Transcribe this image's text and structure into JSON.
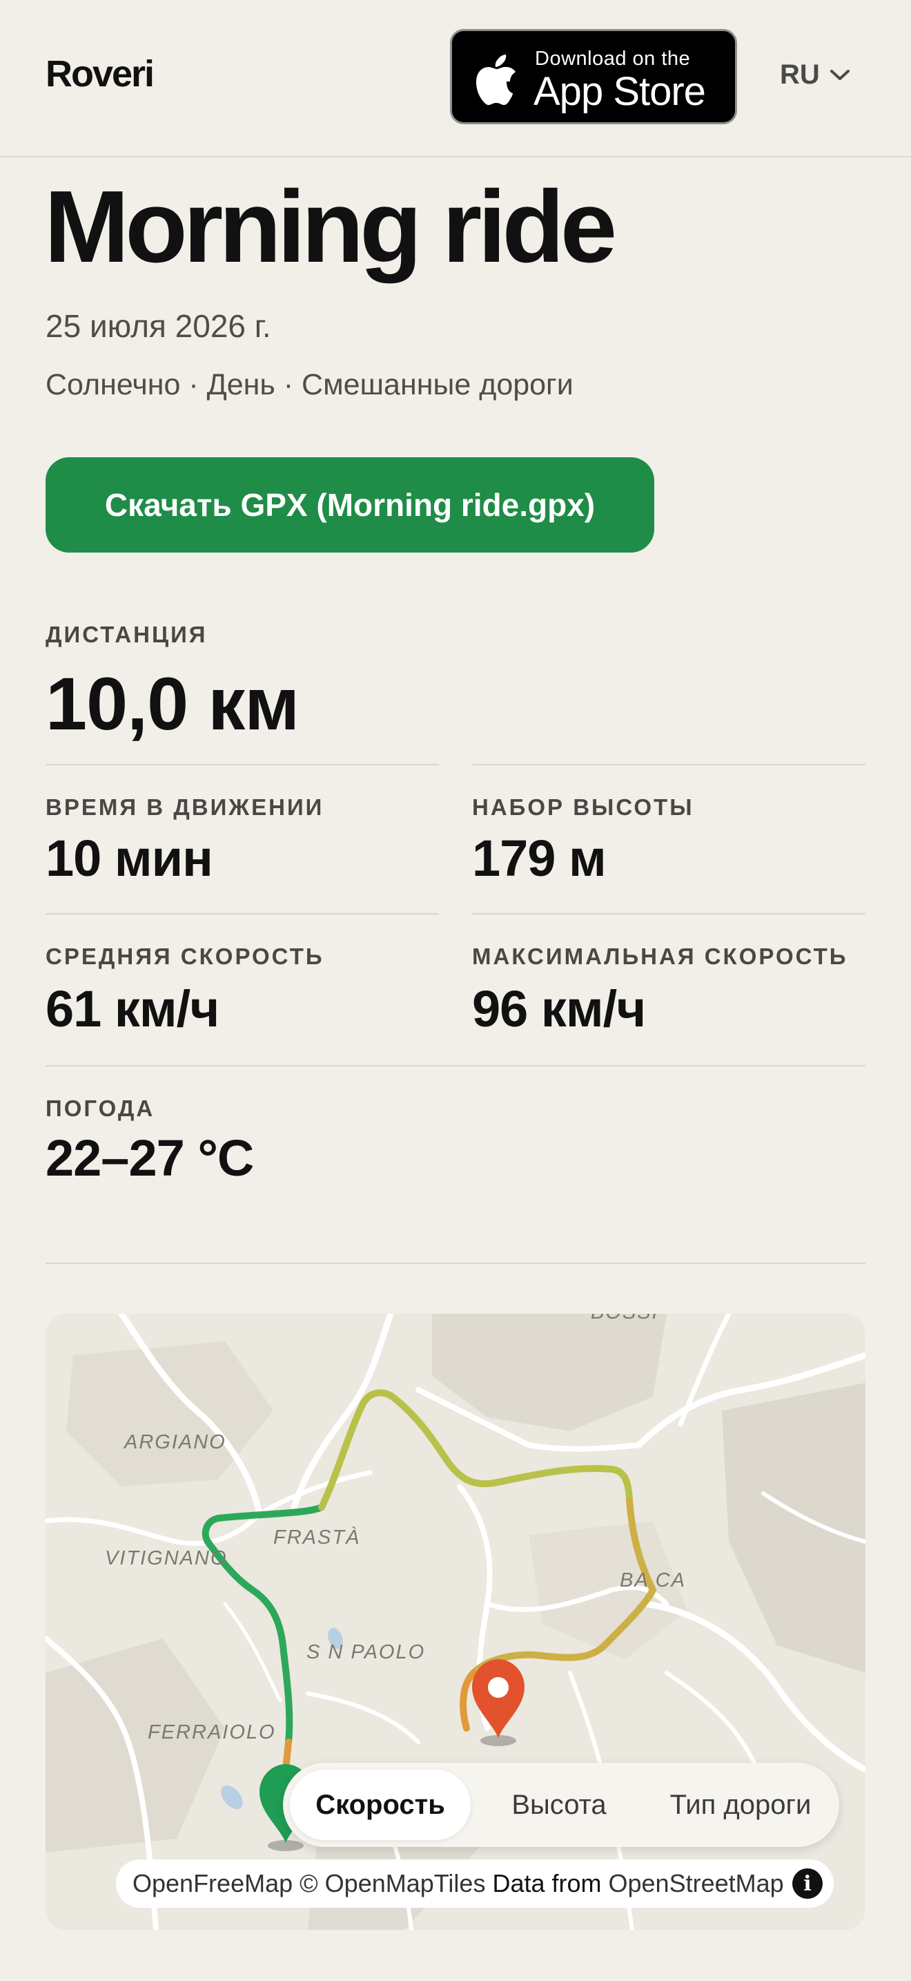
{
  "header": {
    "logo": "Roveri",
    "appstore": {
      "small": "Download on the",
      "big": "App Store"
    },
    "language": "RU"
  },
  "ride": {
    "title": "Morning ride",
    "date": "25 июля 2026 г.",
    "tags": "Солнечно · День · Смешанные дороги",
    "download_label": "Скачать GPX (Morning ride.gpx)"
  },
  "stats": {
    "distance": {
      "label": "ДИСТАНЦИЯ",
      "value": "10,0 км"
    },
    "moving_time": {
      "label": "ВРЕМЯ В ДВИЖЕНИИ",
      "value": "10 мин"
    },
    "elevation_gain": {
      "label": "НАБОР ВЫСОТЫ",
      "value": "179 м"
    },
    "avg_speed": {
      "label": "СРЕДНЯЯ СКОРОСТЬ",
      "value": "61 км/ч"
    },
    "max_speed": {
      "label": "МАКСИМАЛЬНАЯ СКОРОСТЬ",
      "value": "96 км/ч"
    },
    "weather": {
      "label": "ПОГОДА",
      "value": "22–27 °C"
    }
  },
  "map": {
    "places": [
      "ARGIANO",
      "FRASTÀ",
      "VITIGNANO",
      "BA CA",
      "S N PAOLO",
      "FERRAIOLO",
      "BOSSI"
    ],
    "tabs": [
      "Скорость",
      "Высота",
      "Тип дороги"
    ],
    "active_tab": "Скорость",
    "attribution": {
      "openfreemap": "OpenFreeMap",
      "openmaptiles": "© OpenMapTiles",
      "data_from": "Data from",
      "osm": "OpenStreetMap"
    },
    "colors": {
      "start": "#1f9d55",
      "finish": "#e2532d",
      "route_slow": "#2da85a",
      "route_mid": "#b8c24a",
      "route_fast": "#e09a3a"
    }
  }
}
